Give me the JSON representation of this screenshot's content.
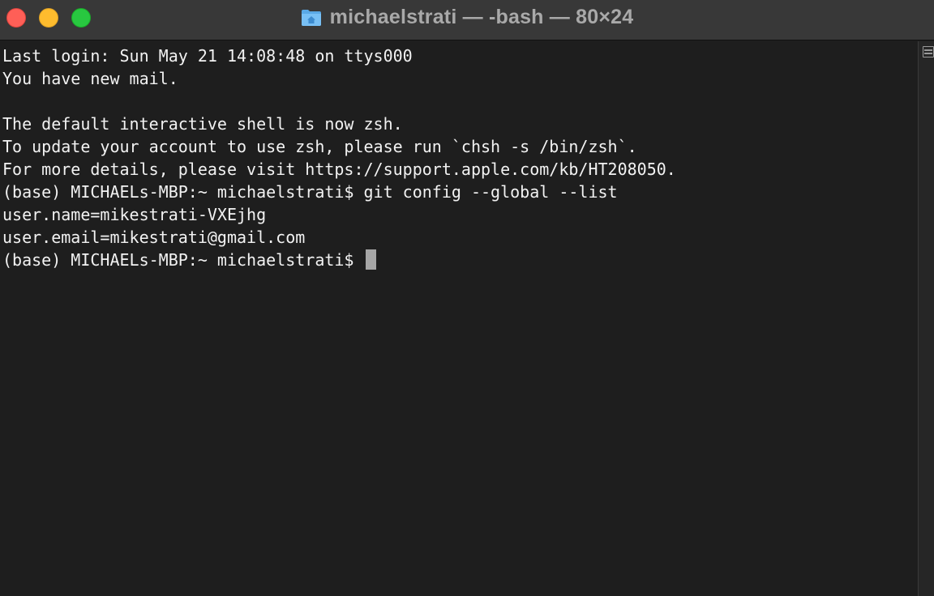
{
  "window": {
    "title": "michaelstrati — -bash — 80×24",
    "title_icon": "home-folder-icon"
  },
  "terminal": {
    "lines": [
      "Last login: Sun May 21 14:08:48 on ttys000",
      "You have new mail.",
      "",
      "The default interactive shell is now zsh.",
      "To update your account to use zsh, please run `chsh -s /bin/zsh`.",
      "For more details, please visit https://support.apple.com/kb/HT208050.",
      "(base) MICHAELs-MBP:~ michaelstrati$ git config --global --list",
      "user.name=mikestrati-VXEjhg",
      "user.email=mikestrati@gmail.com"
    ],
    "prompt": "(base) MICHAELs-MBP:~ michaelstrati$ "
  },
  "colors": {
    "background": "#1e1e1e",
    "text": "#f2f2f2",
    "titlebar": "#383838",
    "close": "#fe5f57",
    "minimize": "#febc2e",
    "zoom": "#28c840"
  }
}
